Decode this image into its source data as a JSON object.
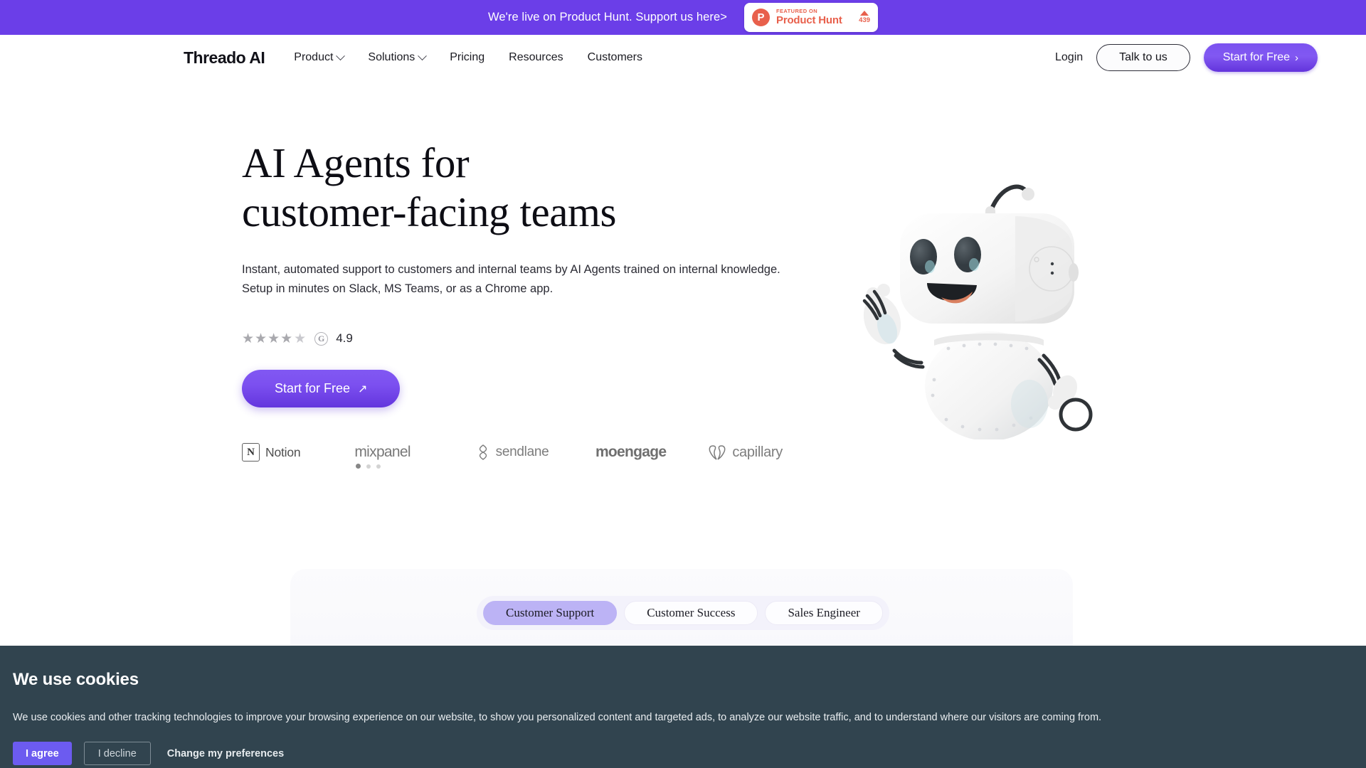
{
  "announcement": {
    "text": "We're live on Product Hunt. Support us here>",
    "badge": {
      "logo_letter": "P",
      "featured_label": "FEATURED ON",
      "name": "Product Hunt",
      "upvotes": "439"
    },
    "background_color": "#6B3EE8"
  },
  "nav": {
    "logo": "Threado AI",
    "links": [
      {
        "label": "Product",
        "has_dropdown": true
      },
      {
        "label": "Solutions",
        "has_dropdown": true
      },
      {
        "label": "Pricing",
        "has_dropdown": false
      },
      {
        "label": "Resources",
        "has_dropdown": false
      },
      {
        "label": "Customers",
        "has_dropdown": false
      }
    ],
    "login_label": "Login",
    "talk_label": "Talk to us",
    "cta_label": "Start for Free",
    "cta_arrow": "›"
  },
  "hero": {
    "title_line1": "AI Agents for",
    "title_line2": "customer-facing teams",
    "subtitle": "Instant, automated support to customers and internal teams by AI Agents trained on internal knowledge. Setup in minutes on Slack, MS Teams, or as a Chrome app.",
    "rating": {
      "stars": "★★★★",
      "half_star": "★",
      "source_icon": "g2-icon",
      "value": "4.9"
    },
    "cta_label": "Start for Free",
    "cta_arrow": "↗",
    "robot_image": "robot-mascot-illustration"
  },
  "logos": {
    "items": [
      {
        "name": "Notion",
        "mark": "N"
      },
      {
        "name": "mixpanel"
      },
      {
        "name": "sendlane"
      },
      {
        "name": "moengage"
      },
      {
        "name": "capillary"
      }
    ],
    "carousel_dots": 3,
    "carousel_active_index": 0
  },
  "tabs": [
    {
      "label": "Customer Support",
      "active": true
    },
    {
      "label": "Customer Success",
      "active": false
    },
    {
      "label": "Sales Engineer",
      "active": false
    }
  ],
  "cookie_banner": {
    "title": "We use cookies",
    "body": "We use cookies and other tracking technologies to improve your browsing experience on our website, to show you personalized content and targeted ads, to analyze our website traffic, and to understand where our visitors are coming from.",
    "agree_label": "I agree",
    "decline_label": "I decline",
    "preferences_label": "Change my preferences",
    "background_color": "#31444F",
    "agree_color": "#6C5BF0"
  }
}
